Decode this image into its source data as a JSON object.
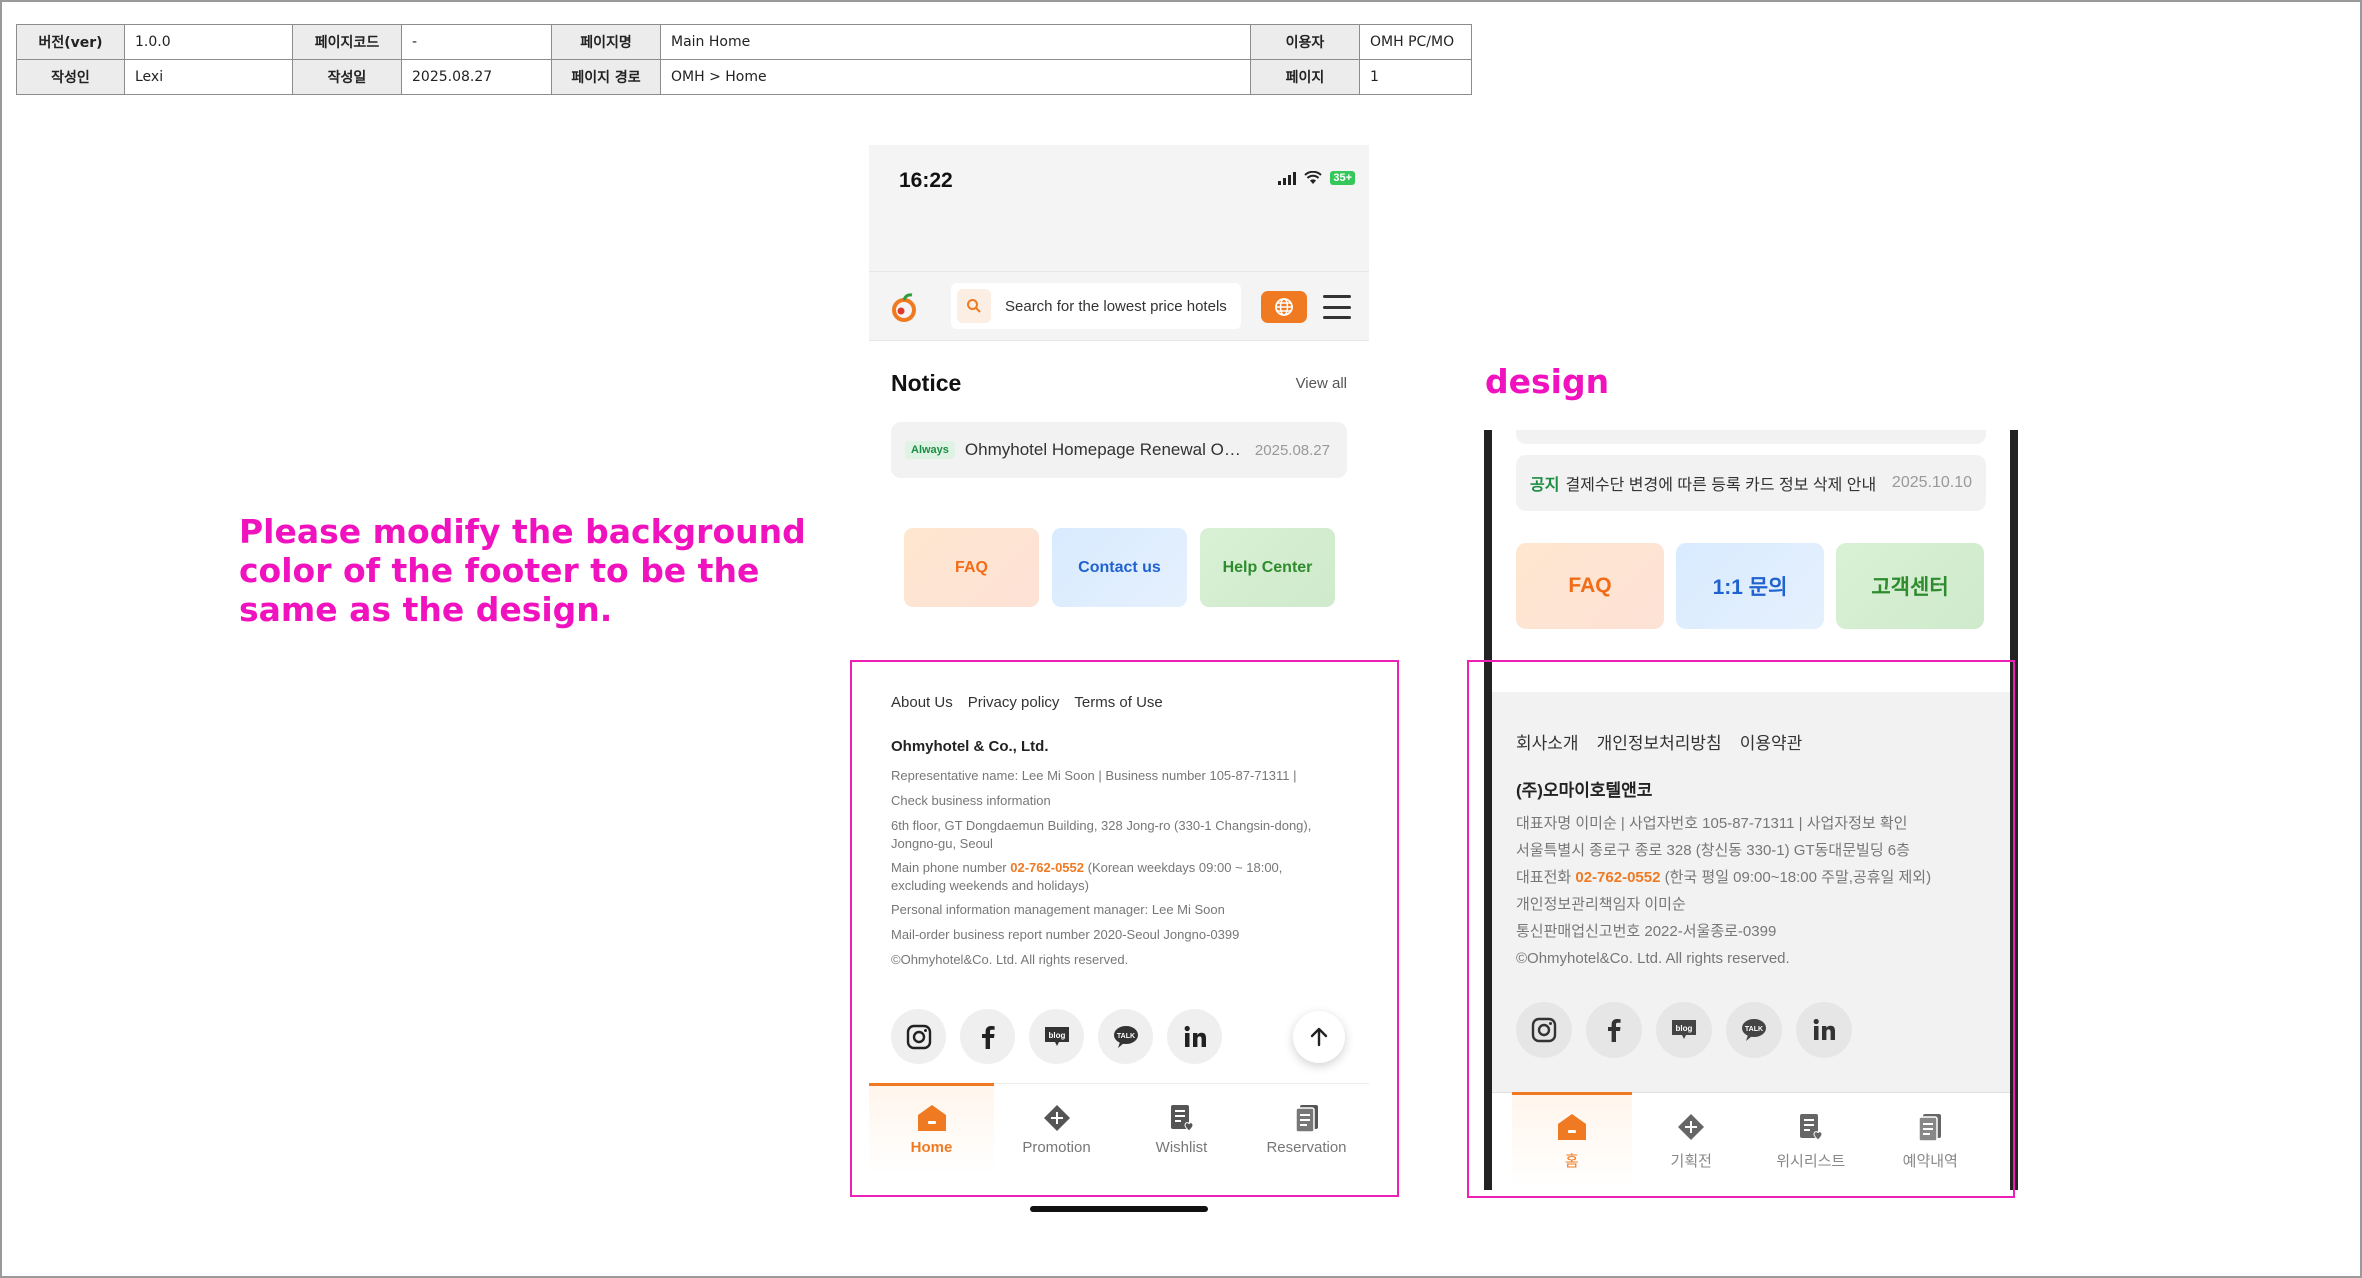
{
  "doc_meta": {
    "row1": [
      "버전(ver)",
      "1.0.0",
      "페이지코드",
      "-",
      "페이지명",
      "Main Home",
      "이용자",
      "OMH PC/MO"
    ],
    "row2": [
      "작성인",
      "Lexi",
      "작성일",
      "2025.08.27",
      "페이지 경로",
      "OMH > Home",
      "페이지",
      "1"
    ]
  },
  "instruction": "Please modify the background color of the footer to be the same as the design.",
  "design_label": "design",
  "phone": {
    "status": {
      "time": "16:22",
      "battery": "35+"
    },
    "search_placeholder": "Search for the lowest price hotels",
    "notice": {
      "title": "Notice",
      "view_all": "View all",
      "item": {
        "badge": "Always",
        "text": "Ohmyhotel Homepage Renewal Op...",
        "date": "2025.08.27"
      }
    },
    "quick": {
      "faq": "FAQ",
      "contact": "Contact us",
      "help": "Help Center"
    },
    "footer": {
      "links": [
        "About Us",
        "Privacy policy",
        "Terms of Use"
      ],
      "company": "Ohmyhotel & Co., Ltd.",
      "rep": "Representative name: Lee Mi Soon",
      "biz": "Business number 105-87-71311",
      "check": "Check business information",
      "address": "6th floor, GT Dongdaemun Building, 328 Jong-ro (330-1 Changsin-dong), Jongno-gu, Seoul",
      "phone_label": "Main phone number",
      "phone": "02-762-0552",
      "phone_hours": "(Korean weekdays 09:00 ~ 18:00, excluding weekends and holidays)",
      "privacy_manager": "Personal information management manager: Lee Mi Soon",
      "mail_order": "Mail-order business report number 2020-Seoul Jongno-0399",
      "copyright": "©Ohmyhotel&Co. Ltd. All rights reserved.",
      "background": "#ffffff"
    },
    "tabs": [
      "Home",
      "Promotion",
      "Wishlist",
      "Reservation"
    ]
  },
  "design": {
    "notice": {
      "tag": "공지",
      "text": "결제수단 변경에 따른 등록 카드 정보 삭제 안내",
      "date": "2025.10.10"
    },
    "quick": {
      "faq": "FAQ",
      "contact": "1:1 문의",
      "help": "고객센터"
    },
    "footer": {
      "links": [
        "회사소개",
        "개인정보처리방침",
        "이용약관"
      ],
      "company": "(주)오마이호텔앤코",
      "line1": "대표자명 이미순  |  사업자번호 105-87-71311  |  사업자정보 확인",
      "line2": "서울특별시 종로구 종로 328 (창신동 330-1) GT동대문빌딩 6층",
      "line3_label": "대표전화",
      "line3_phone": "02-762-0552",
      "line3_rest": "(한국 평일 09:00~18:00 주말,공휴일 제외)",
      "line4": "개인정보관리책임자 이미순",
      "line5": "통신판매업신고번호 2022-서울종로-0399",
      "line6": "©Ohmyhotel&Co. Ltd. All rights reserved.",
      "background": "#f2f2f2"
    },
    "tabs": [
      "홈",
      "기획전",
      "위시리스트",
      "예약내역"
    ]
  },
  "colors": {
    "accent": "#f07a22",
    "annotation": "#f012be"
  }
}
